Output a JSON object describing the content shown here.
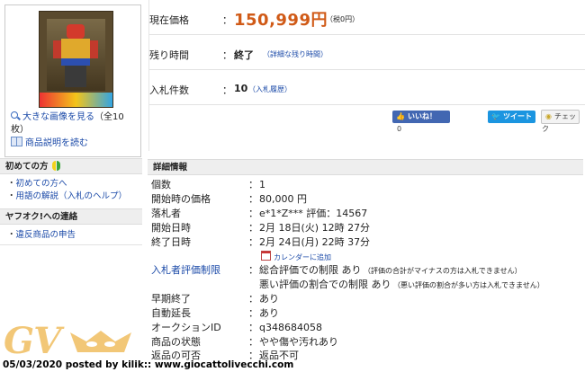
{
  "left": {
    "enlarge_text": "大きな画像を見る",
    "enlarge_count": "（全10枚）",
    "read_desc": "商品説明を読む",
    "beginner_title": "初めての方",
    "beginner_links": [
      "初めての方へ",
      "用語の解説（入札のヘルプ）"
    ],
    "contact_title": "ヤフオク!への連絡",
    "contact_links": [
      "違反商品の申告"
    ]
  },
  "summary": {
    "current_price_label": "現在価格",
    "current_price": "150,999円",
    "tax_note": "（税0円）",
    "remaining_label": "残り時間",
    "remaining_value": "終了",
    "remaining_link": "（詳細な残り時間）",
    "bids_label": "入札件数",
    "bids_value": "10",
    "bids_link": "（入札履歴）",
    "colon": "："
  },
  "social": {
    "like": "いいね！",
    "like_count": "0",
    "tweet": "ツイート",
    "check": "チェック"
  },
  "details": {
    "title": "詳細情報",
    "rows": [
      {
        "label": "個数",
        "value": "1"
      },
      {
        "label": "開始時の価格",
        "value": "80,000 円"
      },
      {
        "label": "落札者",
        "value": "e*1*Z*** 評価：14567"
      },
      {
        "label": "開始日時",
        "value": "2月 18日(火) 12時 27分"
      },
      {
        "label": "終了日時",
        "value": "2月 24日(月) 22時 37分"
      },
      {
        "label": "入札者評価制限",
        "value": "総合評価での制限 あり",
        "note": "（評価の合計がマイナスの方は入札できません）",
        "link": true
      },
      {
        "label": "",
        "value": "悪い評価の割合での制限 あり",
        "note": "（悪い評価の割合が多い方は入札できません）"
      },
      {
        "label": "早期終了",
        "value": "あり"
      },
      {
        "label": "自動延長",
        "value": "あり"
      },
      {
        "label": "オークションID",
        "value": "q348684058"
      },
      {
        "label": "商品の状態",
        "value": "やや傷や汚れあり"
      },
      {
        "label": "返品の可否",
        "value": "返品不可"
      }
    ],
    "calendar_link": "カレンダーに追加"
  },
  "watermark": "GV",
  "footer": "05/03/2020 posted by kilik:: www.giocattolivecchi.com"
}
